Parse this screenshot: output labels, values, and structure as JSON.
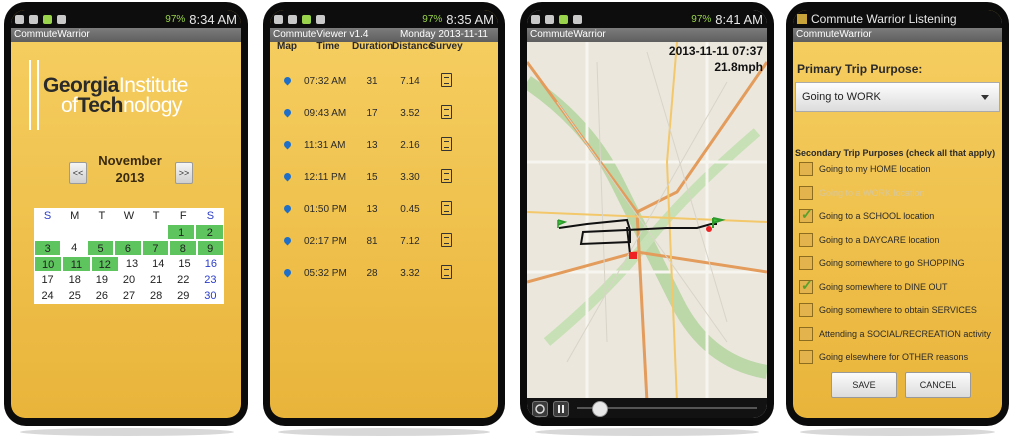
{
  "screen1": {
    "status": {
      "battery": "97%",
      "time": "8:34 AM"
    },
    "app_title": "CommuteWarrior",
    "logo": {
      "line1_bold": "Georgia",
      "line1_rest": "Institute",
      "line2_pre": "of",
      "line2_bold": "Tech",
      "line2_rest": "nology"
    },
    "prev_label": "<<",
    "next_label": ">>",
    "month": "November",
    "year": "2013",
    "weekdays": [
      "S",
      "M",
      "T",
      "W",
      "T",
      "F",
      "S"
    ],
    "weeks": [
      [
        "",
        "",
        "",
        "",
        "",
        "1",
        "2"
      ],
      [
        "3",
        "4",
        "5",
        "6",
        "7",
        "8",
        "9"
      ],
      [
        "10",
        "11",
        "12",
        "13",
        "14",
        "15",
        "16"
      ],
      [
        "17",
        "18",
        "19",
        "20",
        "21",
        "22",
        "23"
      ],
      [
        "24",
        "25",
        "26",
        "27",
        "28",
        "29",
        "30"
      ]
    ],
    "highlight_color": "#5ec45e"
  },
  "screen2": {
    "status": {
      "battery": "97%",
      "time": "8:35 AM"
    },
    "app_title": "CommuteViewer v1.4",
    "date_label": "Monday  2013-11-11",
    "columns": [
      "Map",
      "Time",
      "Duration",
      "Distance",
      "Survey"
    ],
    "trips": [
      {
        "time": "07:32 AM",
        "duration": "31",
        "distance": "7.14"
      },
      {
        "time": "09:43 AM",
        "duration": "17",
        "distance": "3.52"
      },
      {
        "time": "11:31 AM",
        "duration": "13",
        "distance": "2.16"
      },
      {
        "time": "12:11 PM",
        "duration": "15",
        "distance": "3.30"
      },
      {
        "time": "01:50 PM",
        "duration": "13",
        "distance": "0.45"
      },
      {
        "time": "02:17 PM",
        "duration": "81",
        "distance": "7.12"
      },
      {
        "time": "05:32 PM",
        "duration": "28",
        "distance": "3.32"
      }
    ],
    "pin_color": "#1f6fc9"
  },
  "screen3": {
    "status": {
      "battery": "97%",
      "time": "8:41 AM"
    },
    "app_title": "CommuteWarrior",
    "timestamp": "2013-11-11 07:37",
    "speed": "21.8mph",
    "playback_progress": 0.12
  },
  "screen4": {
    "notification": "Commute Warrior Listening",
    "app_title": "CommuteWarrior",
    "primary_title": "Primary Trip Purpose:",
    "primary_value": "Going to WORK",
    "secondary_title": "Secondary Trip Purposes (check all that apply)",
    "options": [
      {
        "label": "Going to my HOME location",
        "checked": false,
        "disabled": false
      },
      {
        "label": "Going to a WORK location",
        "checked": false,
        "disabled": true
      },
      {
        "label": "Going to a SCHOOL location",
        "checked": true,
        "disabled": false
      },
      {
        "label": "Going to a DAYCARE location",
        "checked": false,
        "disabled": false
      },
      {
        "label": "Going somewhere to go SHOPPING",
        "checked": false,
        "disabled": false
      },
      {
        "label": "Going somewhere to DINE OUT",
        "checked": true,
        "disabled": false
      },
      {
        "label": "Going somewhere to obtain SERVICES",
        "checked": false,
        "disabled": false
      },
      {
        "label": "Attending a SOCIAL/RECREATION activity",
        "checked": false,
        "disabled": false
      },
      {
        "label": "Going elsewhere for OTHER reasons",
        "checked": false,
        "disabled": false
      }
    ],
    "save_label": "SAVE",
    "cancel_label": "CANCEL"
  }
}
